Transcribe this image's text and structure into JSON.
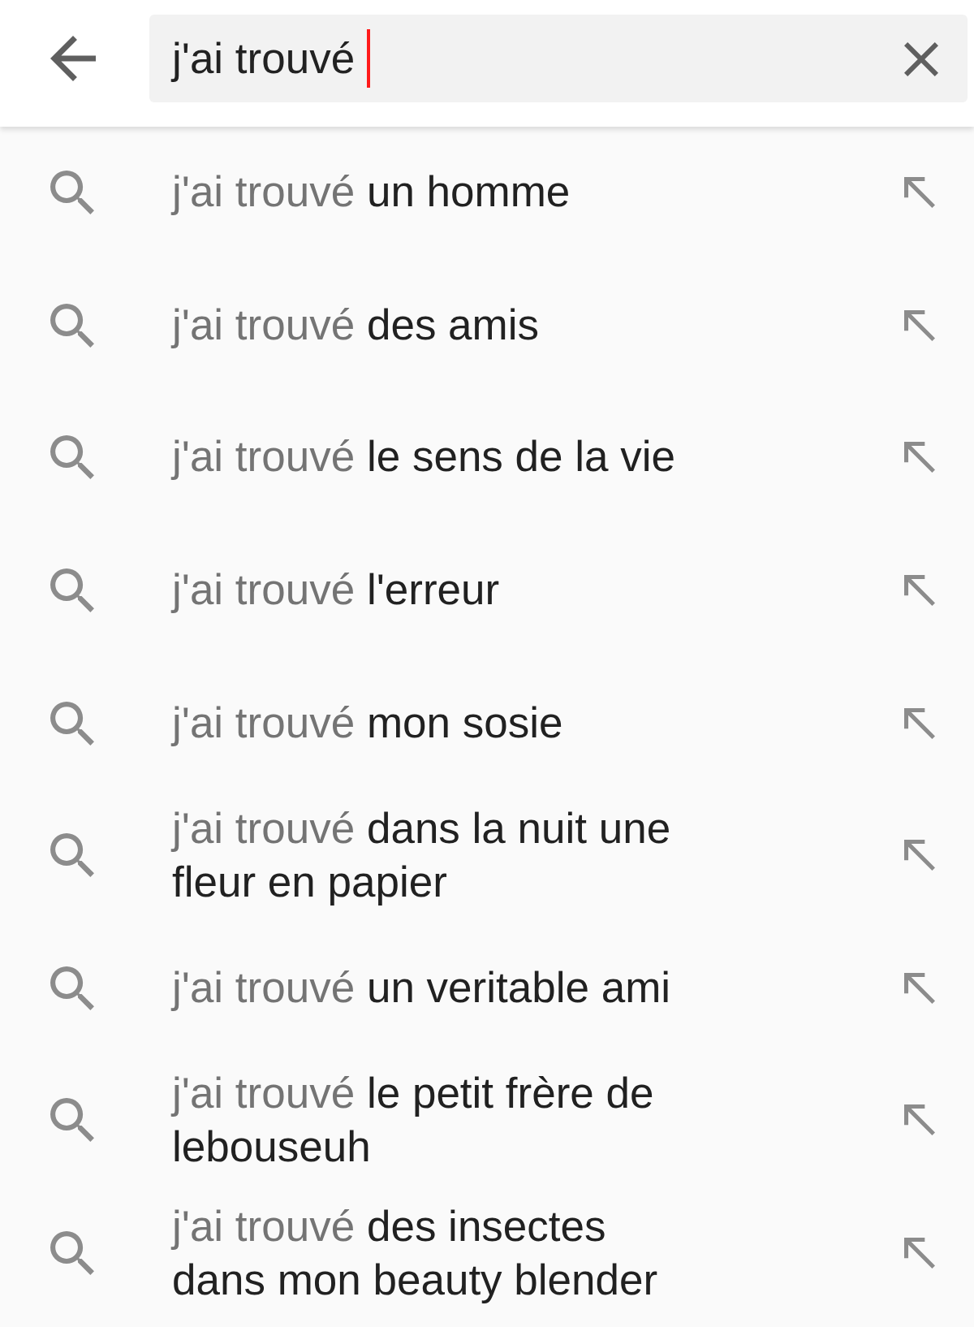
{
  "search": {
    "value": "j'ai trouvé"
  },
  "suggestions": [
    {
      "prefix": "j'ai trouvé",
      "completion": "un homme"
    },
    {
      "prefix": "j'ai trouvé",
      "completion": "des amis"
    },
    {
      "prefix": "j'ai trouvé",
      "completion": "le sens de la vie"
    },
    {
      "prefix": "j'ai trouvé",
      "completion": "l'erreur"
    },
    {
      "prefix": "j'ai trouvé",
      "completion": "mon sosie"
    },
    {
      "prefix": "j'ai trouvé",
      "completion": "dans la nuit une fleur en papier"
    },
    {
      "prefix": "j'ai trouvé",
      "completion": "un veritable ami"
    },
    {
      "prefix": "j'ai trouvé",
      "completion": "le petit frère de lebouseuh"
    },
    {
      "prefix": "j'ai trouvé",
      "completion": "des insectes dans mon beauty blender"
    }
  ]
}
